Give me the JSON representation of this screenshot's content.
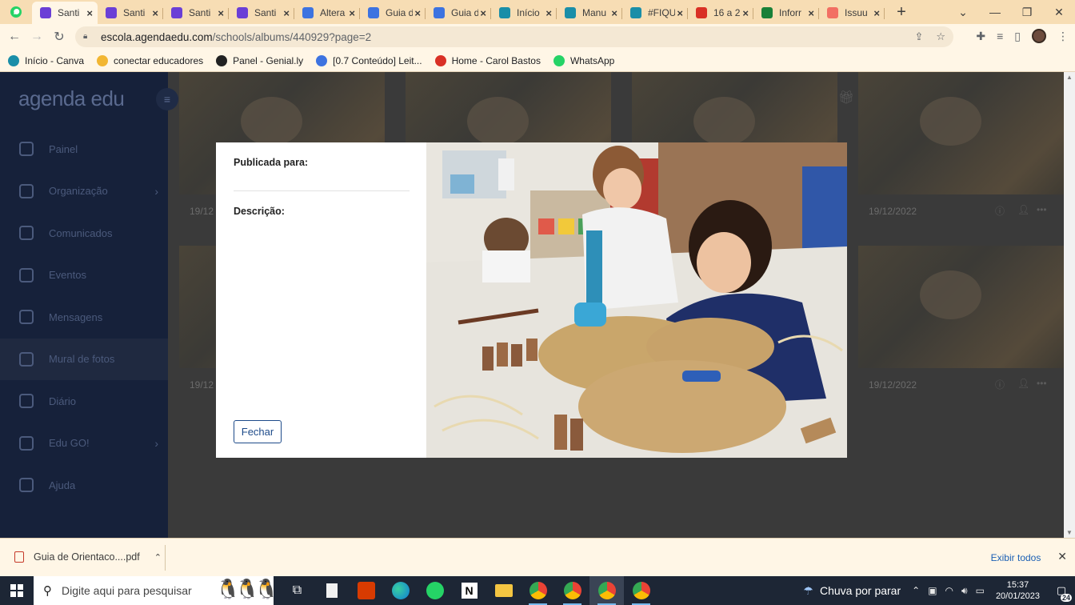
{
  "browser": {
    "tabs": [
      {
        "label": "Santi",
        "favicon": "agenda-edu-icon",
        "color": "#6a3fd6",
        "active": true
      },
      {
        "label": "Santi",
        "favicon": "agenda-edu-icon",
        "color": "#6a3fd6"
      },
      {
        "label": "Santi",
        "favicon": "agenda-edu-icon",
        "color": "#6a3fd6"
      },
      {
        "label": "Santi",
        "favicon": "agenda-edu-icon",
        "color": "#6a3fd6"
      },
      {
        "label": "Altera",
        "favicon": "google-docs-icon",
        "color": "#3d73e0"
      },
      {
        "label": "Guia d",
        "favicon": "google-docs-icon",
        "color": "#3d73e0"
      },
      {
        "label": "Guia d",
        "favicon": "google-docs-icon",
        "color": "#3d73e0"
      },
      {
        "label": "Início",
        "favicon": "canva-icon",
        "color": "#1a8ea8"
      },
      {
        "label": "Manu",
        "favicon": "canva-icon",
        "color": "#1a8ea8"
      },
      {
        "label": "#FIQU",
        "favicon": "canva-icon",
        "color": "#1a8ea8"
      },
      {
        "label": "16 a 2",
        "favicon": "calendar-icon",
        "color": "#d93025"
      },
      {
        "label": "Inforr",
        "favicon": "google-sheets-icon",
        "color": "#188038"
      },
      {
        "label": "Issuu",
        "favicon": "issuu-icon",
        "color": "#f26f63"
      }
    ],
    "url_host": "escola.agendaedu.com",
    "url_path": "/schools/albums/440929?page=2",
    "bookmarks": [
      {
        "label": "Início - Canva",
        "icon": "canva-icon",
        "color": "#1a8ea8"
      },
      {
        "label": "conectar educadores",
        "icon": "bulb-icon",
        "color": "#f2b632"
      },
      {
        "label": "Panel - Genial.ly",
        "icon": "genially-icon",
        "color": "#222222"
      },
      {
        "label": "[0.7 Conteúdo] Leit...",
        "icon": "google-docs-icon",
        "color": "#3d73e0"
      },
      {
        "label": "Home - Carol Bastos",
        "icon": "cb-icon",
        "color": "#d93025"
      },
      {
        "label": "WhatsApp",
        "icon": "whatsapp-icon",
        "color": "#25d366"
      }
    ]
  },
  "app": {
    "brand": "agenda edu",
    "nav": [
      {
        "label": "Painel",
        "icon": "dashboard-icon"
      },
      {
        "label": "Organização",
        "icon": "organization-icon",
        "has_children": true
      },
      {
        "label": "Comunicados",
        "icon": "megaphone-icon"
      },
      {
        "label": "Eventos",
        "icon": "calendar-icon"
      },
      {
        "label": "Mensagens",
        "icon": "chat-icon"
      },
      {
        "label": "Mural de fotos",
        "icon": "camera-icon",
        "selected": true
      },
      {
        "label": "Diário",
        "icon": "diary-icon"
      },
      {
        "label": "Edu GO!",
        "icon": "rocket-icon",
        "has_children": true
      },
      {
        "label": "Ajuda",
        "icon": "help-icon"
      }
    ],
    "card_dates": [
      "19/12",
      "19/12/2022",
      "19/12",
      "19/12/2022"
    ]
  },
  "modal": {
    "published_label": "Publicada para:",
    "description_label": "Descrição:",
    "close_button": "Fechar"
  },
  "downloads": {
    "file": "Guia de Orientaco....pdf",
    "show_all": "Exibir todos"
  },
  "taskbar": {
    "search_placeholder": "Digite aqui para pesquisar",
    "weather": "Chuva por parar",
    "time": "15:37",
    "date": "20/01/2023",
    "notifications": "24"
  }
}
